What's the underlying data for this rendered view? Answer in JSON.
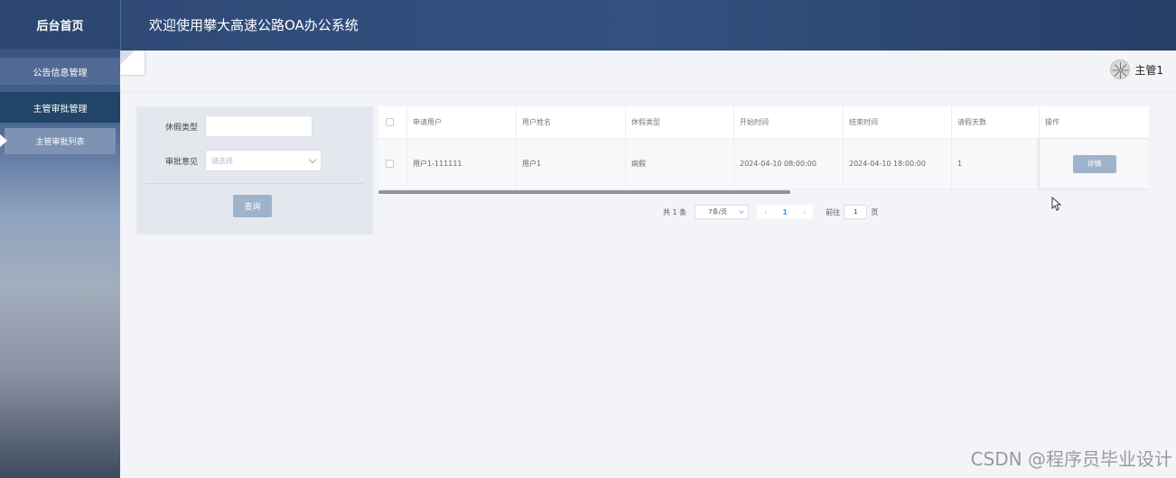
{
  "sidebar": {
    "home": "后台首页",
    "items": [
      {
        "label": "公告信息管理"
      },
      {
        "label": "主管审批管理"
      }
    ],
    "subitems": [
      {
        "label": "主管审批列表"
      }
    ]
  },
  "header": {
    "title": "欢迎使用攀大高速公路OA办公系统"
  },
  "user": {
    "name": "主管1"
  },
  "search": {
    "leave_type_label": "休假类型",
    "leave_type_value": "",
    "opinion_label": "审批意见",
    "opinion_placeholder": "请选择",
    "query_label": "查询"
  },
  "table": {
    "columns": [
      "申请用户",
      "用户姓名",
      "休假类型",
      "开始时间",
      "结束时间",
      "请假天数",
      "操作"
    ],
    "rows": [
      {
        "applicant": "用户1-111111",
        "name": "用户1",
        "type": "病假",
        "start": "2024-04-10 08:00:00",
        "end": "2024-04-10 18:00:00",
        "days": "1",
        "action": "详情"
      }
    ]
  },
  "pagination": {
    "total": "共 1 条",
    "page_size": "7条/页",
    "prev": "‹",
    "current": "1",
    "next": "›",
    "goto_label": "前往",
    "goto_value": "1",
    "goto_unit": "页"
  },
  "watermark": "CSDN @程序员毕业设计"
}
